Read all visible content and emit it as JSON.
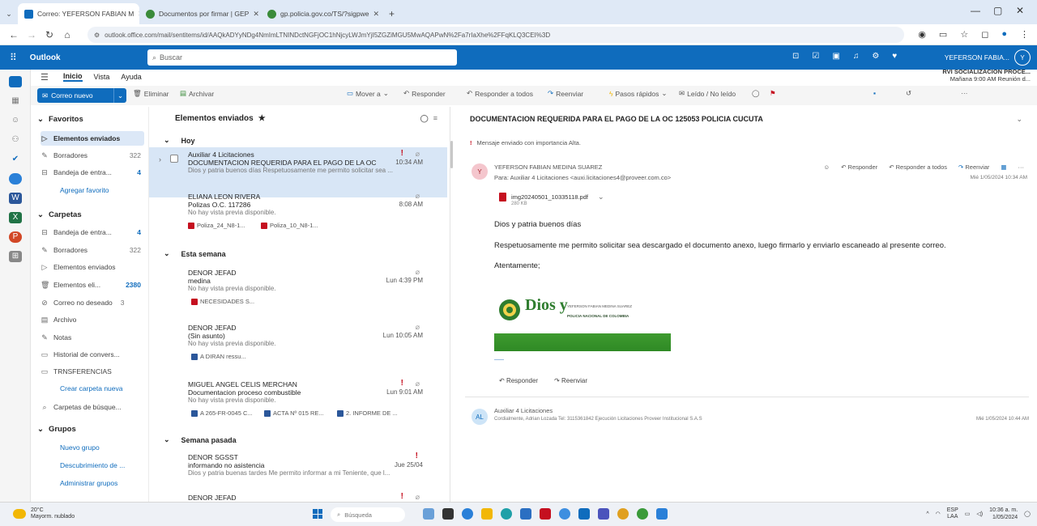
{
  "browser": {
    "tabs": [
      {
        "label": "Correo: YEFERSON FABIAN M",
        "active": true
      },
      {
        "label": "Documentos por firmar | GEP",
        "active": false
      },
      {
        "label": "gp.policia.gov.co/TS/?sigpwe",
        "active": false
      }
    ],
    "url": "outlook.office.com/mail/sentitems/id/AAQkADYyNDg4NmImLTNINDctNGFjOC1hNjcyLWJmYjI5ZGZiMGU5MwAQAPwN%2Fa7rIaXhe%2FFqKLQ3CEI%3D"
  },
  "outlook": {
    "app_name": "Outlook",
    "search_placeholder": "Buscar",
    "user_name": "YEFERSON FABIA...",
    "user_initials": "Y"
  },
  "ribbon": {
    "tabs": [
      "Inicio",
      "Vista",
      "Ayuda"
    ],
    "new_mail": "Correo nuevo",
    "delete": "Eliminar",
    "archive": "Archivar",
    "move": "Mover a",
    "reply": "Responder",
    "reply_all": "Responder a todos",
    "forward": "Reenviar",
    "quick_steps": "Pasos rápidos",
    "read_unread": "Leído / No leído",
    "reminder_title": "RVI SOCIALIZACION PROCE...",
    "reminder_sub": "Mañana 9:00 AM Reunión d..."
  },
  "folders": {
    "favorites_title": "Favoritos",
    "favorites": [
      {
        "label": "Elementos enviados",
        "count": ""
      },
      {
        "label": "Borradores",
        "count": "322"
      },
      {
        "label": "Bandeja de entra...",
        "count": "4"
      }
    ],
    "add_favorite": "Agregar favorito",
    "folders_title": "Carpetas",
    "folders": [
      {
        "label": "Bandeja de entra...",
        "count": "4"
      },
      {
        "label": "Borradores",
        "count": "322"
      },
      {
        "label": "Elementos enviados",
        "count": ""
      },
      {
        "label": "Elementos eli...",
        "count": "2380"
      },
      {
        "label": "Correo no deseado",
        "count": "3"
      },
      {
        "label": "Archivo",
        "count": ""
      },
      {
        "label": "Notas",
        "count": ""
      },
      {
        "label": "Historial de convers...",
        "count": ""
      },
      {
        "label": "TRNSFERENCIAS",
        "count": ""
      }
    ],
    "new_folder": "Crear carpeta nueva",
    "search_folders": "Carpetas de búsque...",
    "groups_title": "Grupos",
    "groups_links": [
      "Nuevo grupo",
      "Descubrimiento de ...",
      "Administrar grupos"
    ]
  },
  "list": {
    "title": "Elementos enviados",
    "groups": [
      "Hoy",
      "Esta semana",
      "Semana pasada"
    ],
    "messages": [
      {
        "sender": "Auxiliar 4 Licitaciones",
        "subject": "DOCUMENTACION REQUERIDA PARA EL PAGO DE LA OC ...",
        "time": "10:34 AM",
        "preview": "Dios y patria buenos días Respetuosamente me permito solicitar sea ...",
        "attachments": []
      },
      {
        "sender": "ELIANA LEON RIVERA",
        "subject": "Polizas O.C. 117286",
        "time": "8:08 AM",
        "preview": "No hay vista previa disponible.",
        "attachments": [
          "Poliza_24_N8-1...",
          "Poliza_10_N8-1..."
        ]
      },
      {
        "sender": "DENOR JEFAD",
        "subject": "medina",
        "time": "Lun 4:39 PM",
        "preview": "No hay vista previa disponible.",
        "attachments": [
          "NECESIDADES S..."
        ]
      },
      {
        "sender": "DENOR JEFAD",
        "subject": "(Sin asunto)",
        "time": "Lun 10:05 AM",
        "preview": "No hay vista previa disponible.",
        "attachments": [
          "A DIRAN ressu..."
        ]
      },
      {
        "sender": "MIGUEL ANGEL CELIS MERCHAN",
        "subject": "Documentacion proceso combustible",
        "time": "Lun 9:01 AM",
        "preview": "No hay vista previa disponible.",
        "attachments": [
          "A 265-FR-0045 C...",
          "ACTA Nº 015 RE...",
          "2. INFORME DE ..."
        ]
      },
      {
        "sender": "DENOR SGSST",
        "subject": "informando no asistencia",
        "time": "Jue 25/04",
        "preview": "Dios y patria buenas tardes Me permito informar a mi Teniente, que l...",
        "attachments": []
      },
      {
        "sender": "DENOR JEFAD",
        "subject": "",
        "time": "",
        "preview": "",
        "attachments": []
      }
    ]
  },
  "reading": {
    "subject": "DOCUMENTACION REQUERIDA PARA EL PAGO DE LA OC 125053 POLICIA CUCUTA",
    "importance": "Mensaje enviado con importancia Alta.",
    "from": "YEFERSON FABIAN MEDINA SUAREZ",
    "to": "Para:  Auxiliar 4 Licitaciones <auxi.licitaciones4@proveer.com.co>",
    "avatar": "Y",
    "date": "Mié 1/05/2024 10:34 AM",
    "actions": [
      "Responder",
      "Responder a todos",
      "Reenviar"
    ],
    "attachment_name": "img20240501_10335118.pdf",
    "attachment_size": "280 KB",
    "body": [
      "Dios y patria buenos días",
      "Respetuosamente me permito solicitar sea descargado el documento anexo, luego firmarlo y enviarlo escaneado al presente correo.",
      "Atentamente;"
    ],
    "signature": {
      "logo_text": "Dios y",
      "name": "YEFERSON FABIAN MEDINA SUAREZ",
      "org": "POLICIA NACIONAL DE COLOMBIA"
    },
    "reply_btn": "Responder",
    "forward_btn": "Reenviar",
    "thread": {
      "avatar": "AL",
      "from": "Auxiliar 4 Licitaciones",
      "preview": "Cordialmente, Adrian Lozada Tel: 3115361842 Ejecución Licitaciones Proveer Institucional S.A.S",
      "time": "Mié 1/05/2024 10:44 AM"
    }
  },
  "taskbar": {
    "temp": "20°C",
    "weather": "Mayorm. nublado",
    "search": "Búsqueda",
    "lang": "ESP",
    "lang2": "LAA",
    "time": "10:36 a. m.",
    "date": "1/05/2024"
  },
  "colors": {
    "accent": "#0f6cbd",
    "flag": "#c50f1f",
    "selected": "#d8e6f6"
  }
}
